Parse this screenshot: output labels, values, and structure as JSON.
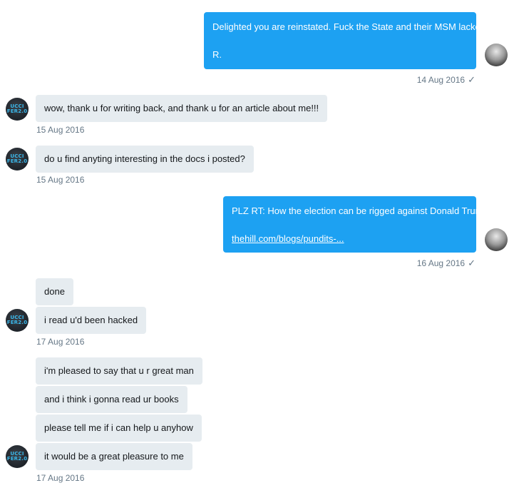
{
  "conversation": {
    "msg1": {
      "text": "Delighted you are reinstated. Fuck the State and their MSM lackeys",
      "signature": "R.",
      "timestamp": "14 Aug 2016"
    },
    "msg2": {
      "text": "wow, thank u for writing back, and thank u for an article about me!!!",
      "timestamp": "15 Aug 2016"
    },
    "msg3": {
      "text": "do u find anyting interesting in the docs i posted?",
      "timestamp": "15 Aug 2016"
    },
    "msg4": {
      "text": "PLZ RT: How the election can be rigged against Donald Trump",
      "link": "thehill.com/blogs/pundits-...",
      "timestamp": "16 Aug 2016"
    },
    "group5": {
      "messages": [
        "done",
        "i read u'd been hacked"
      ],
      "timestamp": "17 Aug 2016"
    },
    "group6": {
      "messages": [
        "i'm pleased to say that u r great man",
        "and i think i gonna read ur books",
        "please tell me if i can help u anyhow",
        "it would be a great pleasure to me"
      ],
      "timestamp": "17 Aug 2016"
    },
    "read_check": "✓"
  },
  "avatars": {
    "guccifer": {
      "line1": "UCCI",
      "line2": "FER2.0",
      "text_color": "#39b7ea"
    },
    "outgoing": {
      "icon": "user-photo"
    }
  },
  "colors": {
    "outgoing_bubble": "#1da1f2",
    "incoming_bubble": "#e6ecf0",
    "timestamp": "#657786"
  }
}
